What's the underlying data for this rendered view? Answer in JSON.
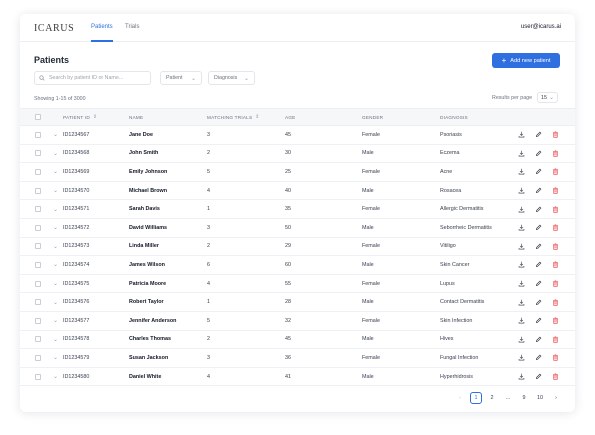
{
  "app": {
    "logo": "ICARUS",
    "user_email": "user@icarus.ai"
  },
  "nav": {
    "tabs": [
      {
        "label": "Patients",
        "active": true
      },
      {
        "label": "Trials",
        "active": false
      }
    ]
  },
  "page": {
    "title": "Patients",
    "add_button_label": "Add new patient",
    "search_placeholder": "Search by patient ID or Name...",
    "filters": [
      {
        "label": "Patient"
      },
      {
        "label": "Diagnosis"
      }
    ],
    "showing_text": "Showing 1-15 of 3000",
    "results_per_page_label": "Results per page",
    "results_per_page_value": "15"
  },
  "table": {
    "columns": [
      "PATIENT ID",
      "NAME",
      "MATCHING TRIALS",
      "AGE",
      "GENDER",
      "DIAGNOSIS"
    ],
    "rows": [
      {
        "id": "ID1234567",
        "name": "Jane Doe",
        "trials": "3",
        "age": "45",
        "gender": "Female",
        "diagnosis": "Psoriasis"
      },
      {
        "id": "ID1234568",
        "name": "John Smith",
        "trials": "2",
        "age": "30",
        "gender": "Male",
        "diagnosis": "Eczema"
      },
      {
        "id": "ID1234569",
        "name": "Emily Johnson",
        "trials": "5",
        "age": "25",
        "gender": "Female",
        "diagnosis": "Acne"
      },
      {
        "id": "ID1234570",
        "name": "Michael Brown",
        "trials": "4",
        "age": "40",
        "gender": "Male",
        "diagnosis": "Rosacea"
      },
      {
        "id": "ID1234571",
        "name": "Sarah Davis",
        "trials": "1",
        "age": "35",
        "gender": "Female",
        "diagnosis": "Allergic Dermatitis"
      },
      {
        "id": "ID1234572",
        "name": "David Williams",
        "trials": "3",
        "age": "50",
        "gender": "Male",
        "diagnosis": "Seborrheic Dermatitis"
      },
      {
        "id": "ID1234573",
        "name": "Linda Miller",
        "trials": "2",
        "age": "29",
        "gender": "Female",
        "diagnosis": "Vitiligo"
      },
      {
        "id": "ID1234574",
        "name": "James Wilson",
        "trials": "6",
        "age": "60",
        "gender": "Male",
        "diagnosis": "Skin Cancer"
      },
      {
        "id": "ID1234575",
        "name": "Patricia Moore",
        "trials": "4",
        "age": "55",
        "gender": "Female",
        "diagnosis": "Lupus"
      },
      {
        "id": "ID1234576",
        "name": "Robert Taylor",
        "trials": "1",
        "age": "28",
        "gender": "Male",
        "diagnosis": "Contact Dermatitis"
      },
      {
        "id": "ID1234577",
        "name": "Jennifer Anderson",
        "trials": "5",
        "age": "32",
        "gender": "Female",
        "diagnosis": "Skin Infection"
      },
      {
        "id": "ID1234578",
        "name": "Charles Thomas",
        "trials": "2",
        "age": "45",
        "gender": "Male",
        "diagnosis": "Hives"
      },
      {
        "id": "ID1234579",
        "name": "Susan Jackson",
        "trials": "3",
        "age": "36",
        "gender": "Female",
        "diagnosis": "Fungal Infection"
      },
      {
        "id": "ID1234580",
        "name": "Daniel White",
        "trials": "4",
        "age": "41",
        "gender": "Male",
        "diagnosis": "Hyperhidrosis"
      }
    ]
  },
  "pagination": {
    "pages": [
      "1",
      "2",
      "...",
      "9",
      "10"
    ],
    "active": "1"
  },
  "icons": {
    "download": "download-icon",
    "edit": "edit-pencil-icon",
    "delete": "trash-icon",
    "search": "search-icon",
    "sort": "sort-arrows-icon"
  },
  "colors": {
    "accent": "#2f6fe0",
    "delete": "#e5484d"
  }
}
